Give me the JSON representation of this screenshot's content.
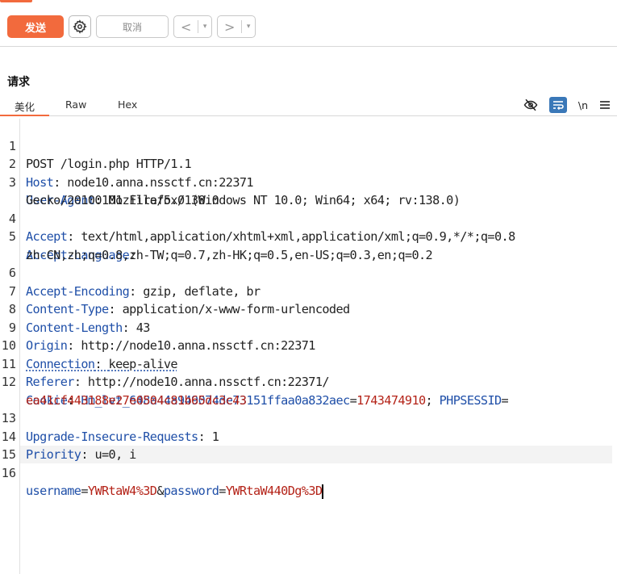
{
  "toolbar": {
    "send_label": "发送",
    "cancel_label": "取消",
    "back_arrow": "<",
    "forward_arrow": ">",
    "dropdown_glyph": "▾"
  },
  "panel": {
    "title": "请求",
    "tabs": [
      "美化",
      "Raw",
      "Hex"
    ],
    "active_tab": "美化",
    "newline_toggle_label": "\\n",
    "icons": [
      "eye-off-icon",
      "word-wrap-icon",
      "newline-icon",
      "menu-icon"
    ]
  },
  "request": {
    "line1": "POST /login.php HTTP/1.1",
    "host_name": "Host",
    "host_value": "node10.anna.nssctf.cn:22371",
    "ua_name": "User-Agent",
    "ua_value_1": "Mozilla/5.0 (Windows NT 10.0; Win64; x64; rv:138.0)",
    "ua_value_2": "Gecko/20100101 Firefox/138.0",
    "accept_name": "Accept",
    "accept_value": "text/html,application/xhtml+xml,application/xml;q=0.9,*/*;q=0.8",
    "al_name": "Accept-Language",
    "al_value": "zh-CN,zh;q=0.8,zh-TW;q=0.7,zh-HK;q=0.5,en-US;q=0.3,en;q=0.2",
    "ae_name": "Accept-Encoding",
    "ae_value": "gzip, deflate, br",
    "ct_name": "Content-Type",
    "ct_value": "application/x-www-form-urlencoded",
    "cl_name": "Content-Length",
    "cl_value": "43",
    "origin_name": "Origin",
    "origin_value": "http://node10.anna.nssctf.cn:22371",
    "conn_name": "Connection",
    "conn_value": "keep-alive",
    "referer_name": "Referer",
    "referer_value": "http://node10.anna.nssctf.cn:22371/",
    "cookie_name": "Cookie",
    "cookie1_key": "Hm_lvt_648a44a949074de73151ffaa0a832aec",
    "cookie1_value": "1743474910",
    "cookie2_key": "PHPSESSID",
    "cookie2_value": "ea41cf443188e27e0504c81b65dc3c43",
    "uir_name": "Upgrade-Insecure-Requests",
    "uir_value": "1",
    "priority_name": "Priority",
    "priority_value": "u=0, i",
    "body_key1": "username",
    "body_val1": "YWRtaW4%3D",
    "body_key2": "password",
    "body_val2": "YWRtaW440Dg%3D"
  },
  "line_numbers": [
    "1",
    "2",
    "3",
    "4",
    "5",
    "6",
    "7",
    "8",
    "9",
    "10",
    "11",
    "12",
    "13",
    "14",
    "15",
    "16"
  ]
}
